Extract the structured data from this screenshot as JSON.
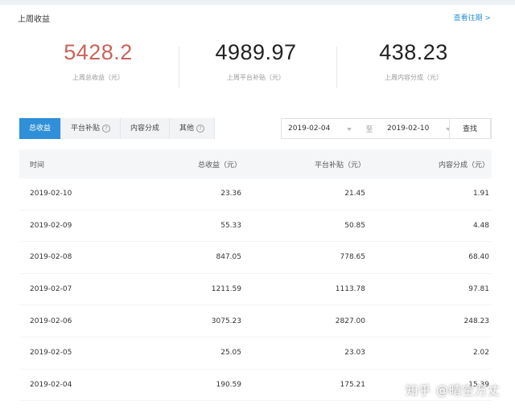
{
  "header": {
    "title": "上周收益",
    "history_link": "查看往期 >"
  },
  "summary": [
    {
      "value": "5428.2",
      "label": "上周总收益（元）",
      "color": "#c8645a"
    },
    {
      "value": "4989.97",
      "label": "上周平台补贴（元）"
    },
    {
      "value": "438.23",
      "label": "上周内容分成（元）"
    }
  ],
  "tabs": [
    {
      "label": "总收益",
      "active": true
    },
    {
      "label": "平台补贴",
      "help_icon": "question-circle-icon"
    },
    {
      "label": "内容分成"
    },
    {
      "label": "其他",
      "help_icon": "question-circle-icon"
    }
  ],
  "filter": {
    "start_date": "2019-02-04",
    "separator": "至",
    "end_date": "2019-02-10",
    "search_label": "查找"
  },
  "table": {
    "columns": [
      "时间",
      "总收益（元）",
      "平台补贴（元）",
      "内容分成（元）"
    ],
    "rows": [
      [
        "2019-02-10",
        "23.36",
        "21.45",
        "1.91"
      ],
      [
        "2019-02-09",
        "55.33",
        "50.85",
        "4.48"
      ],
      [
        "2019-02-08",
        "847.05",
        "778.65",
        "68.40"
      ],
      [
        "2019-02-07",
        "1211.59",
        "1113.78",
        "97.81"
      ],
      [
        "2019-02-06",
        "3075.23",
        "2827.00",
        "248.23"
      ],
      [
        "2019-02-05",
        "25.05",
        "23.03",
        "2.02"
      ],
      [
        "2019-02-04",
        "190.59",
        "175.21",
        "15.39"
      ]
    ]
  },
  "watermark": "知乎 @晴空万丈",
  "colors": {
    "accent": "#2f8fd8",
    "highlight": "#c8645a"
  }
}
